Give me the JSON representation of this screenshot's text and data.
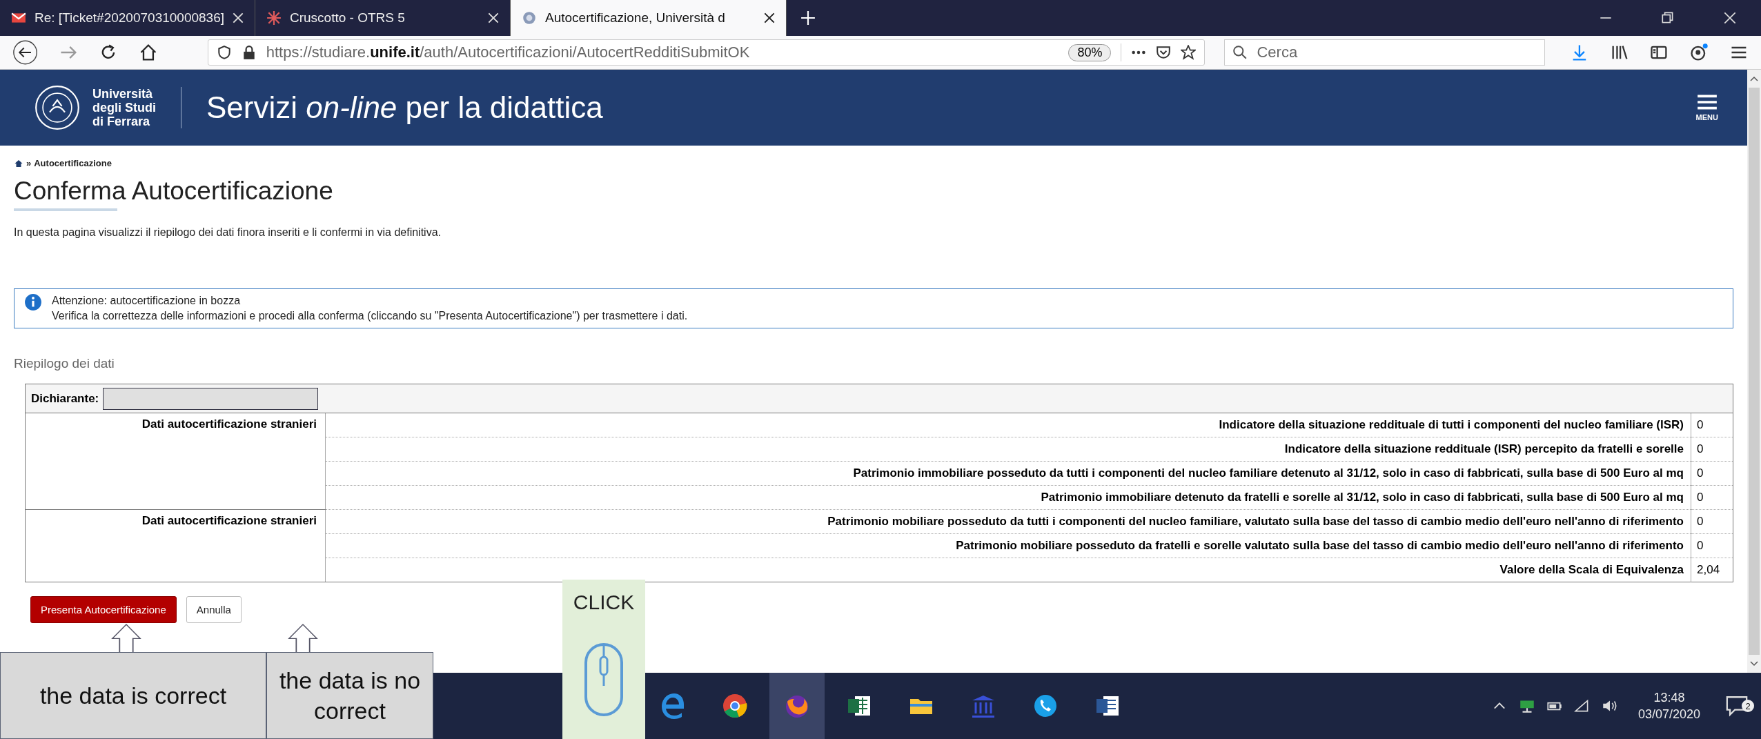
{
  "browser": {
    "tabs": [
      {
        "title": "Re: [Ticket#2020070310000836]",
        "kind": "mail",
        "selected": false
      },
      {
        "title": "Cruscotto - OTRS 5",
        "kind": "star",
        "selected": false
      },
      {
        "title": "Autocertificazione, Università d",
        "kind": "crest",
        "selected": true
      }
    ],
    "address": {
      "url": "https://studiare.**unife.it**/auth/Autocertificazioni/AutocertRedditiSubmitOK",
      "zoom": "80%"
    },
    "search": {
      "placeholder": "Cerca"
    }
  },
  "site_header": {
    "logo_lines": [
      "Università",
      "degli Studi",
      "di Ferrara"
    ],
    "title": "Servizi *on-line* per la didattica",
    "menu_label": "MENU"
  },
  "breadcrumb": {
    "separator": "»",
    "current": "Autocertificazione"
  },
  "page_title": "Conferma Autocertificazione",
  "intro": "In questa pagina visualizzi il riepilogo dei dati finora inseriti e li confermi in via definitiva.",
  "notice": {
    "title": "Attenzione: autocertificazione in bozza",
    "text": "Verifica la correttezza delle informazioni e procedi alla conferma (cliccando su \"Presenta Autocertificazione\") per trasmettere i dati."
  },
  "summary": {
    "heading": "Riepilogo dei dati",
    "declarant_label": "Dichiarante:",
    "groups": [
      {
        "label": "Dati autocertificazione stranieri",
        "rows": [
          {
            "label": "Indicatore della situazione reddituale di tutti i componenti del nucleo familiare (ISR)",
            "value": "0"
          },
          {
            "label": "Indicatore della situazione reddituale (ISR) percepito da fratelli e sorelle",
            "value": "0"
          },
          {
            "label": "Patrimonio immobiliare posseduto da tutti i componenti del nucleo familiare detenuto al 31/12, solo in caso di fabbricati, sulla base di 500 Euro al mq",
            "value": "0"
          },
          {
            "label": "Patrimonio immobiliare detenuto da fratelli e sorelle al 31/12, solo in caso di fabbricati, sulla base di 500 Euro al mq",
            "value": "0"
          }
        ]
      },
      {
        "label": "Dati autocertificazione stranieri",
        "rows": [
          {
            "label": "Patrimonio mobiliare posseduto da tutti i componenti del nucleo familiare, valutato sulla base del tasso di cambio medio dell'euro nell'anno di riferimento",
            "value": "0"
          },
          {
            "label": "Patrimonio mobiliare posseduto da fratelli e sorelle valutato sulla base del tasso di cambio medio dell'euro nell'anno di riferimento",
            "value": "0"
          },
          {
            "label": "Valore della Scala di Equivalenza",
            "value": "2,04"
          }
        ]
      }
    ]
  },
  "buttons": [
    {
      "label": "Presenta Autocertificazione",
      "kind": "primary"
    },
    {
      "label": "Annulla",
      "kind": "secondary"
    }
  ],
  "annotations": {
    "notes": [
      "the data is correct",
      "the data is no correct"
    ],
    "click_label": "CLICK"
  },
  "taskbar": {
    "apps": [
      {
        "kind": "edge",
        "selected": false
      },
      {
        "kind": "chrome",
        "selected": false
      },
      {
        "kind": "firefox",
        "selected": true
      },
      {
        "kind": "excel",
        "selected": false
      },
      {
        "kind": "folder",
        "selected": false
      },
      {
        "kind": "museum",
        "selected": false
      },
      {
        "kind": "phone",
        "selected": false
      },
      {
        "kind": "word",
        "selected": false
      }
    ],
    "clock": {
      "time": "13:48",
      "date": "03/07/2020"
    },
    "notifications": "2"
  }
}
